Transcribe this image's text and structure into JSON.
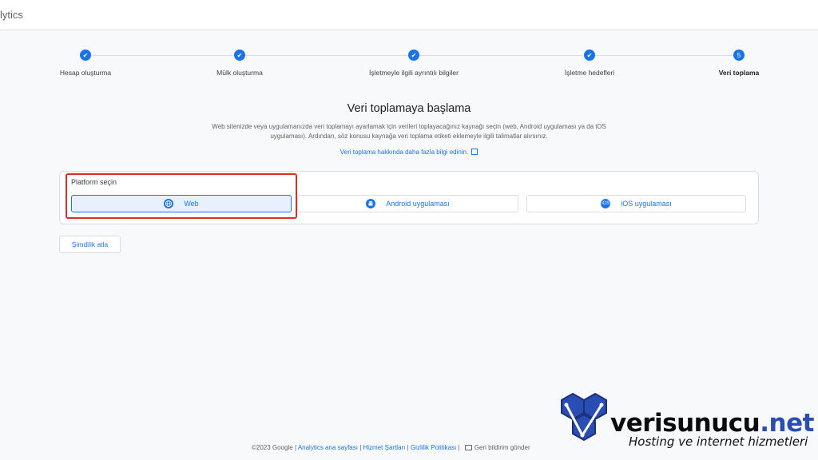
{
  "app": {
    "title": "lytics"
  },
  "steps": [
    {
      "label": "Hesap oluşturma",
      "state": "done",
      "icon": "check-icon"
    },
    {
      "label": "Mülk oluşturma",
      "state": "done",
      "icon": "check-icon"
    },
    {
      "label": "İşletmeyle ilgili ayrıntılı bilgiler",
      "state": "done",
      "icon": "check-icon"
    },
    {
      "label": "İşletme hedefleri",
      "state": "done",
      "icon": "check-icon"
    },
    {
      "label": "Veri toplama",
      "state": "active",
      "number": "5"
    }
  ],
  "main": {
    "heading": "Veri toplamaya başlama",
    "description": "Web sitenizde veya uygulamanızda veri toplamayı ayarlamak için verileri toplayacağınız kaynağı seçin (web, Android uygulaması ya da iOS uygulaması). Ardından, söz konusu kaynağa veri toplama etiketi eklemeyle ilgili talimatlar alırsınız.",
    "learn_more": "Veri toplama hakkında daha fazla bilgi edinin.",
    "platform_label": "Platform seçin",
    "platforms": [
      {
        "label": "Web",
        "icon": "globe-icon",
        "selected": true
      },
      {
        "label": "Android uygulaması",
        "icon": "android-icon",
        "selected": false
      },
      {
        "label": "iOS uygulaması",
        "icon": "ios-icon",
        "icon_text": "iOS",
        "selected": false
      }
    ],
    "skip_label": "Şimdilik atla"
  },
  "footer": {
    "copyright": "©2023 Google",
    "sep": " | ",
    "links": [
      "Analytics ana sayfası",
      "Hizmet Şartları",
      "Gizlilik Politikası"
    ],
    "feedback": "Geri bildirim gönder"
  },
  "watermark": {
    "name_main": "verisunucu",
    "name_suffix": ".net",
    "tagline": "Hosting ve internet hizmetleri"
  },
  "colors": {
    "accent": "#1a73e8",
    "highlight": "#d93025",
    "brand_blue": "#2a4db3"
  }
}
